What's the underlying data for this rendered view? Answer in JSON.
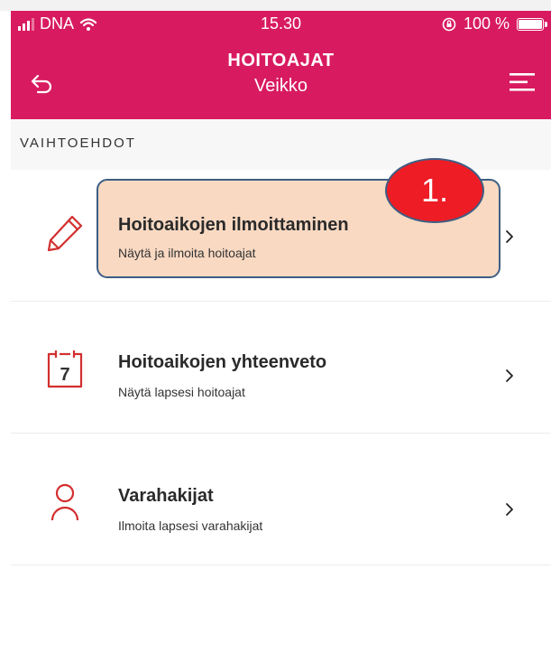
{
  "status_bar": {
    "carrier": "DNA",
    "time": "15.30",
    "battery": "100 %"
  },
  "header": {
    "title": "HOITOAJAT",
    "subtitle": "Veikko",
    "back_icon": "back-arrow-icon",
    "menu_icon": "hamburger-menu-icon"
  },
  "section": {
    "label": "VAIHTOEHDOT"
  },
  "options": [
    {
      "title": "Hoitoaikojen ilmoittaminen",
      "subtitle": "Näytä ja ilmoita hoitoajat",
      "icon": "pencil-icon"
    },
    {
      "title": "Hoitoaikojen yhteenveto",
      "subtitle": "Näytä lapsesi hoitoajat",
      "icon": "calendar-icon",
      "icon_text": "7"
    },
    {
      "title": "Varahakijat",
      "subtitle": "Ilmoita lapsesi varahakijat",
      "icon": "person-icon"
    }
  ],
  "annotation": {
    "step_label": "1."
  },
  "colors": {
    "header_bg": "#d81b60",
    "accent_icon": "#d32f2f",
    "highlight_fill": "#f9d9c2",
    "highlight_border": "#3e5e84",
    "badge_fill": "#ee1c24"
  }
}
